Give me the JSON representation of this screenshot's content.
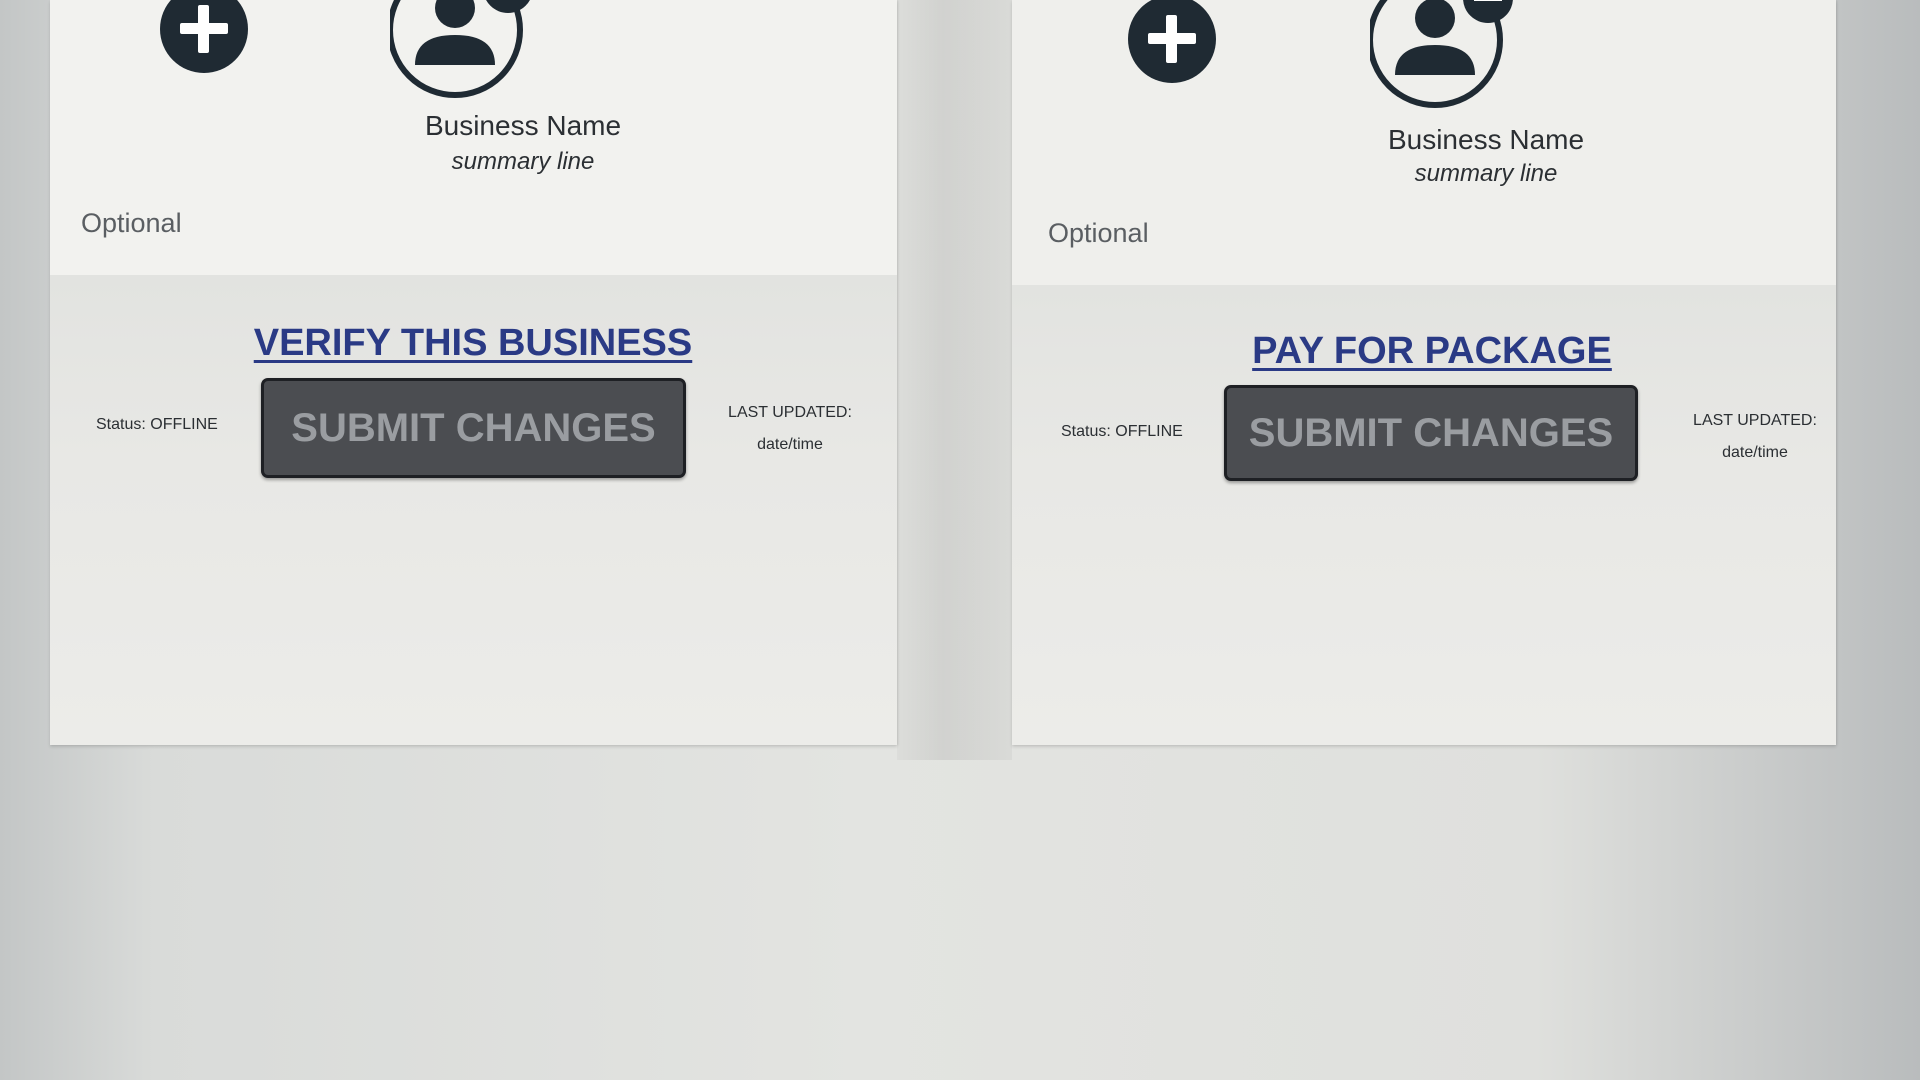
{
  "cards": [
    {
      "business_name": "Business Name",
      "summary": "summary line",
      "optional_label": "Optional",
      "action_link": "VERIFY THIS BUSINESS",
      "status": "Status: OFFLINE",
      "submit_label": "SUBMIT CHANGES",
      "last_updated_label": "LAST UPDATED:",
      "last_updated_value": "date/time"
    },
    {
      "business_name": "Business Name",
      "summary": "summary line",
      "optional_label": "Optional",
      "action_link": "PAY FOR PACKAGE",
      "status": "Status: OFFLINE",
      "submit_label": "SUBMIT CHANGES",
      "last_updated_label": "LAST UPDATED:",
      "last_updated_value": "date/time"
    }
  ],
  "icons": {
    "add": "plus-circle-icon",
    "avatar": "user-remove-icon"
  },
  "colors": {
    "link": "#2a3a85",
    "button_bg": "#4b4d51",
    "button_text": "#9a9da1",
    "icon_dark": "#1f2a33"
  }
}
